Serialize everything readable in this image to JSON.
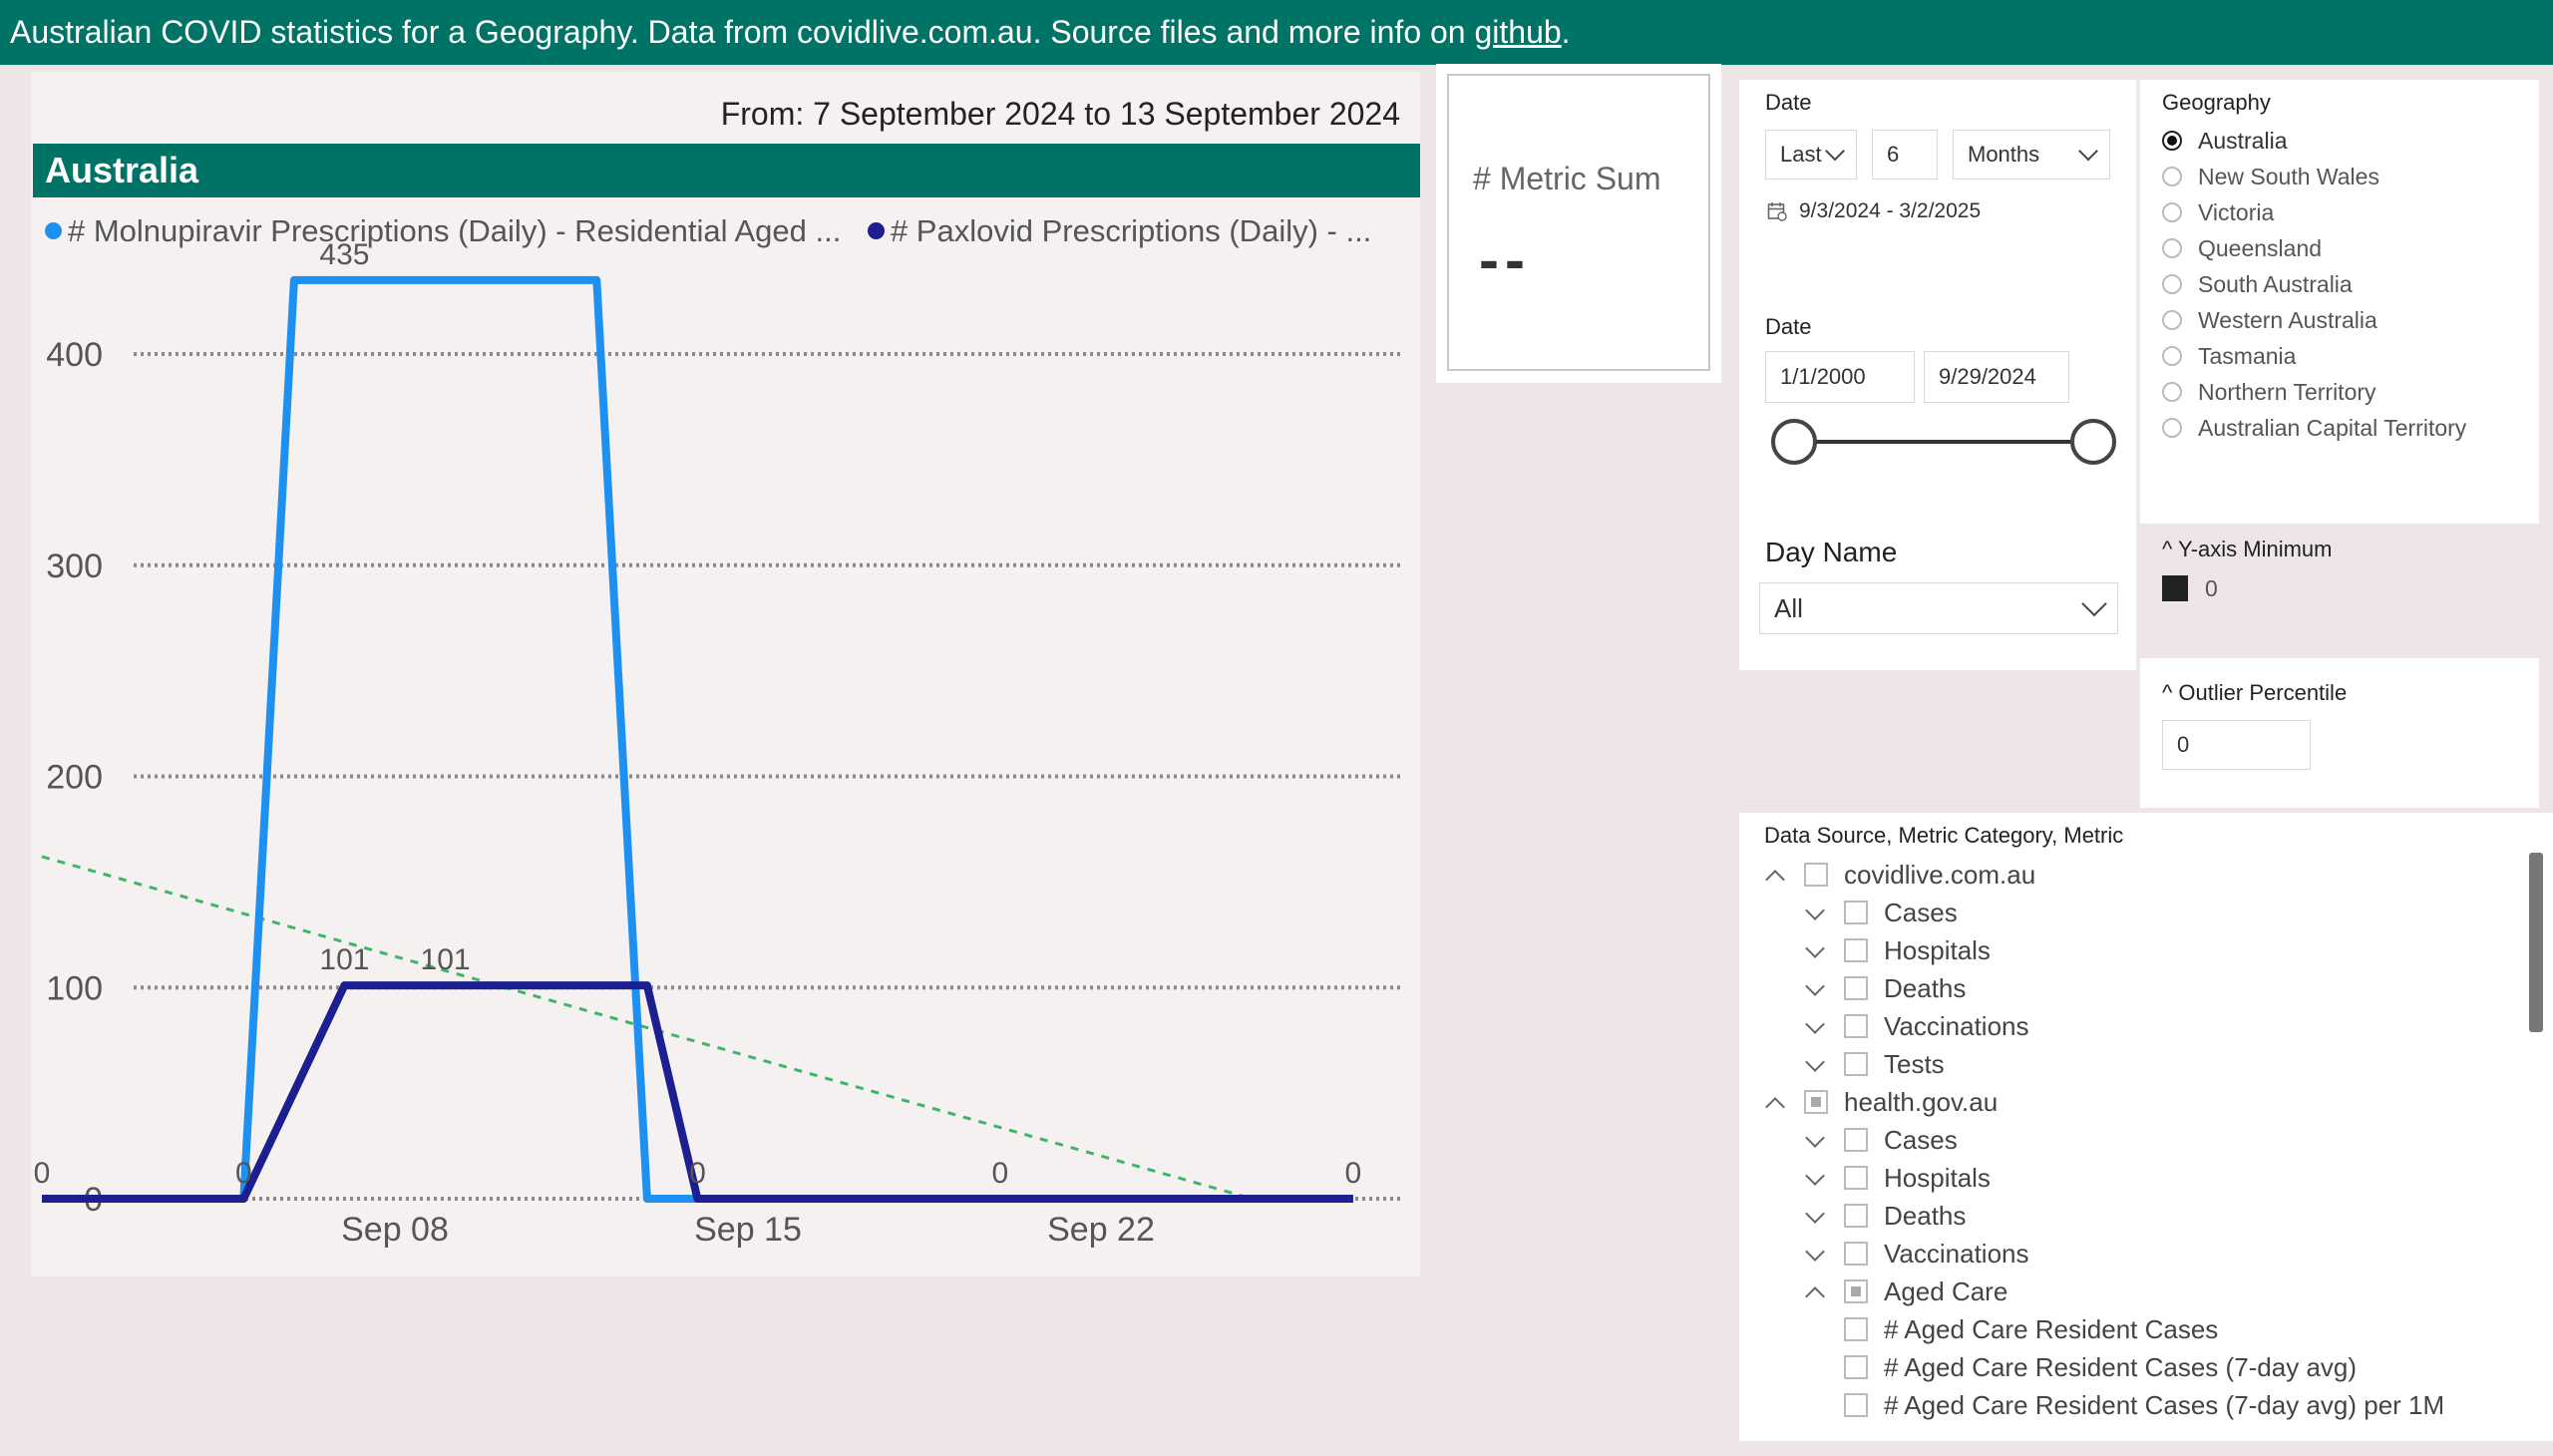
{
  "header": {
    "text": "Australian COVID statistics for a Geography. Data from covidlive.com.au. Source files and more info on ",
    "link": "github",
    "suffix": "."
  },
  "chart_panel": {
    "date_range": "From: 7 September 2024 to 13 September 2024",
    "geography_title": "Australia"
  },
  "chart_data": {
    "type": "line",
    "legend": [
      {
        "name": "# Molnupiravir Prescriptions (Daily) - Residential Aged ...",
        "color": "#1e90f0"
      },
      {
        "name": "# Paxlovid Prescriptions (Daily) - ...",
        "color": "#1b1f8f"
      }
    ],
    "ylim": [
      0,
      435
    ],
    "yticks": [
      0,
      100,
      200,
      300,
      400
    ],
    "xticks": [
      "Sep 08",
      "Sep 15",
      "Sep 22"
    ],
    "x_positions_note": "day offset from Sep 08 tick",
    "series": [
      {
        "name": "# Molnupiravir Prescriptions (Daily) - Residential Aged ...",
        "color": "#1e90f0",
        "width": 8,
        "points": [
          [
            -7,
            0
          ],
          [
            -3,
            0
          ],
          [
            -2,
            435
          ],
          [
            4,
            435
          ],
          [
            5,
            0
          ],
          [
            12,
            0
          ],
          [
            19,
            0
          ]
        ]
      },
      {
        "name": "# Paxlovid Prescriptions (Daily) - ...",
        "color": "#1b1f8f",
        "width": 8,
        "points": [
          [
            -7,
            0
          ],
          [
            -3,
            0
          ],
          [
            -1,
            101
          ],
          [
            5,
            101
          ],
          [
            6,
            0
          ],
          [
            12,
            0
          ],
          [
            19,
            0
          ]
        ]
      }
    ],
    "trend": {
      "color": "#3fb56a",
      "points": [
        [
          -7,
          162
        ],
        [
          17,
          0
        ]
      ]
    },
    "data_labels": [
      {
        "x": -7,
        "y": 0,
        "text": "0"
      },
      {
        "x": -3,
        "y": 0,
        "text": "0"
      },
      {
        "x": -1,
        "y": 435,
        "text": "435"
      },
      {
        "x": -1,
        "y": 101,
        "text": "101"
      },
      {
        "x": 1,
        "y": 101,
        "text": "101"
      },
      {
        "x": 6,
        "y": 0,
        "text": "0"
      },
      {
        "x": 12,
        "y": 0,
        "text": "0"
      },
      {
        "x": 19,
        "y": 0,
        "text": "0"
      }
    ]
  },
  "metric_card": {
    "label": "# Metric Sum",
    "value": "--"
  },
  "date_slicer_relative": {
    "title": "Date",
    "mode": "Last",
    "count": "6",
    "unit": "Months",
    "range": "9/3/2024 - 3/2/2025"
  },
  "date_slicer_between": {
    "title": "Date",
    "start": "1/1/2000",
    "end": "9/29/2024"
  },
  "day_name": {
    "title": "Day Name",
    "value": "All"
  },
  "geography": {
    "title": "Geography",
    "options": [
      {
        "label": "Australia",
        "selected": true
      },
      {
        "label": "New South Wales",
        "selected": false
      },
      {
        "label": "Victoria",
        "selected": false
      },
      {
        "label": "Queensland",
        "selected": false
      },
      {
        "label": "South Australia",
        "selected": false
      },
      {
        "label": "Western Australia",
        "selected": false
      },
      {
        "label": "Tasmania",
        "selected": false
      },
      {
        "label": "Northern Territory",
        "selected": false
      },
      {
        "label": "Australian Capital Territory",
        "selected": false
      }
    ]
  },
  "y_axis_min": {
    "title": "^ Y-axis Minimum",
    "value": "0"
  },
  "outlier": {
    "title": "^ Outlier Percentile",
    "value": "0"
  },
  "tree": {
    "title": "Data Source, Metric Category, Metric",
    "rows": [
      {
        "label": "covidlive.com.au",
        "level": 0,
        "chevron": "up",
        "check": "empty"
      },
      {
        "label": "Cases",
        "level": 1,
        "chevron": "down",
        "check": "empty"
      },
      {
        "label": "Hospitals",
        "level": 1,
        "chevron": "down",
        "check": "empty"
      },
      {
        "label": "Deaths",
        "level": 1,
        "chevron": "down",
        "check": "empty"
      },
      {
        "label": "Vaccinations",
        "level": 1,
        "chevron": "down",
        "check": "empty"
      },
      {
        "label": "Tests",
        "level": 1,
        "chevron": "down",
        "check": "empty"
      },
      {
        "label": "health.gov.au",
        "level": 0,
        "chevron": "up",
        "check": "partial"
      },
      {
        "label": "Cases",
        "level": 1,
        "chevron": "down",
        "check": "empty"
      },
      {
        "label": "Hospitals",
        "level": 1,
        "chevron": "down",
        "check": "empty"
      },
      {
        "label": "Deaths",
        "level": 1,
        "chevron": "down",
        "check": "empty"
      },
      {
        "label": "Vaccinations",
        "level": 1,
        "chevron": "down",
        "check": "empty"
      },
      {
        "label": "Aged Care",
        "level": 1,
        "chevron": "up",
        "check": "partial"
      },
      {
        "label": "# Aged Care Resident Cases",
        "level": 2,
        "chevron": "none",
        "check": "empty"
      },
      {
        "label": "# Aged Care Resident Cases (7-day avg)",
        "level": 2,
        "chevron": "none",
        "check": "empty"
      },
      {
        "label": "# Aged Care Resident Cases (7-day avg) per 1M",
        "level": 2,
        "chevron": "none",
        "check": "empty"
      }
    ]
  }
}
